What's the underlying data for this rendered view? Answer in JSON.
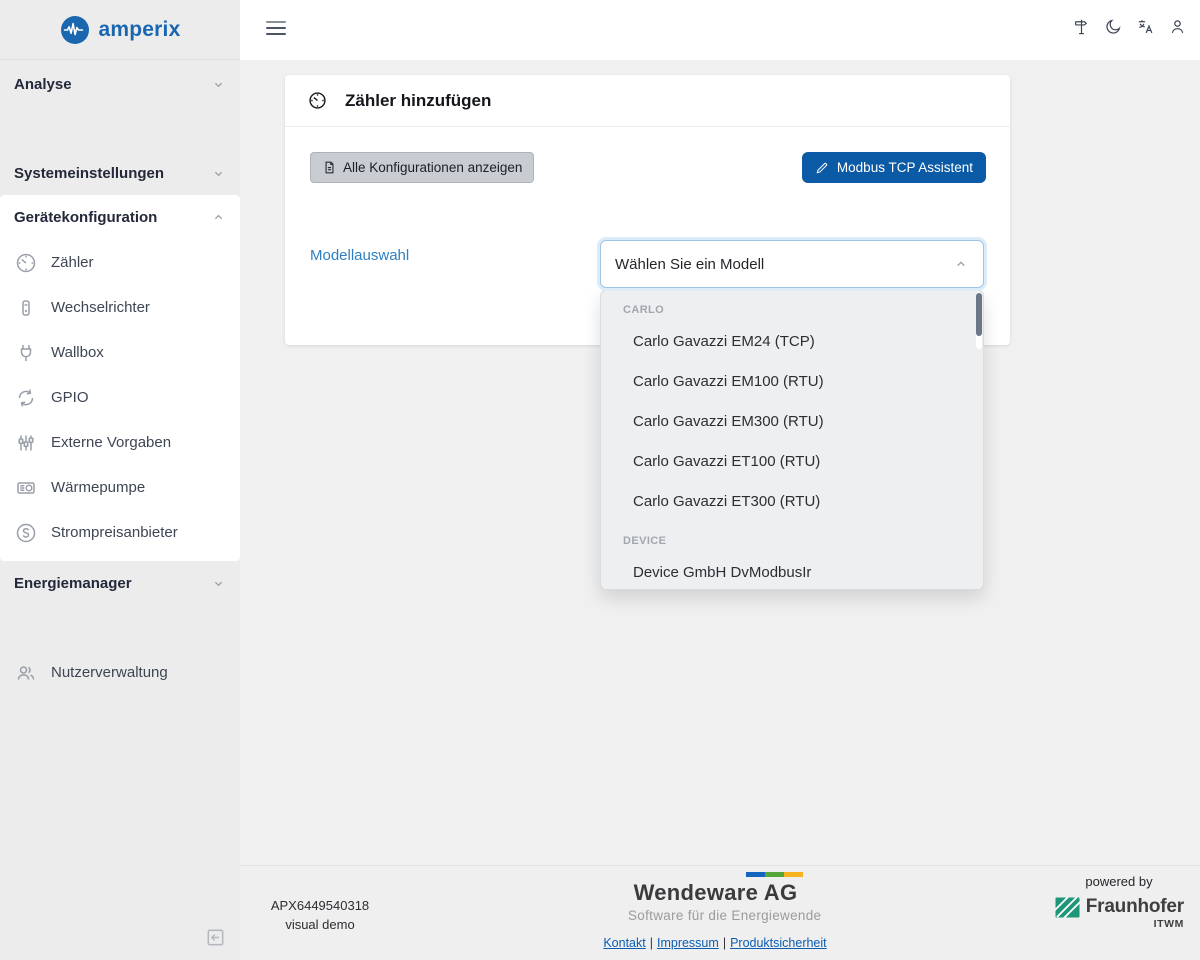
{
  "brand": {
    "name": "amperix"
  },
  "topbar": {
    "icons": [
      "signpost-icon",
      "dark-mode-icon",
      "translate-icon",
      "account-icon"
    ]
  },
  "sidebar": {
    "groups": [
      {
        "label": "Analyse",
        "state": "collapsed"
      },
      {
        "label": "Systemeinstellungen",
        "state": "collapsed"
      },
      {
        "label": "Gerätekonfiguration",
        "state": "expanded"
      },
      {
        "label": "Energiemanager",
        "state": "collapsed"
      }
    ],
    "device_items": [
      {
        "label": "Zähler",
        "icon": "meter-icon"
      },
      {
        "label": "Wechselrichter",
        "icon": "inverter-icon"
      },
      {
        "label": "Wallbox",
        "icon": "plug-icon"
      },
      {
        "label": "GPIO",
        "icon": "gpio-icon"
      },
      {
        "label": "Externe Vorgaben",
        "icon": "sliders-icon"
      },
      {
        "label": "Wärmepumpe",
        "icon": "heatpump-icon"
      },
      {
        "label": "Strompreisanbieter",
        "icon": "price-icon"
      }
    ],
    "user_item": {
      "label": "Nutzerverwaltung",
      "icon": "users-icon"
    }
  },
  "main": {
    "card": {
      "title": "Zähler hinzufügen",
      "show_all_button": "Alle Konfigurationen anzeigen",
      "assistant_button": "Modbus TCP Assistent",
      "model_label": "Modellauswahl",
      "select_value": "Wählen Sie ein Modell"
    },
    "dropdown": {
      "groups": [
        {
          "label": "CARLO",
          "items": [
            "Carlo Gavazzi EM24 (TCP)",
            "Carlo Gavazzi EM100 (RTU)",
            "Carlo Gavazzi EM300 (RTU)",
            "Carlo Gavazzi ET100 (RTU)",
            "Carlo Gavazzi ET300 (RTU)"
          ]
        },
        {
          "label": "DEVICE",
          "items": [
            "Device GmbH DvModbusIr"
          ]
        }
      ]
    }
  },
  "footer": {
    "device_id": "APX6449540318",
    "mode": "visual demo",
    "company": "Wendeware AG",
    "tagline": "Software für die Energiewende",
    "links": [
      {
        "label": "Kontakt"
      },
      {
        "label": "Impressum"
      },
      {
        "label": "Produktsicherheit"
      }
    ],
    "separator": "|",
    "powered_by": "powered by",
    "partner": "Fraunhofer",
    "partner_institute": "ITWM"
  },
  "colors": {
    "brand_blue": "#1a67b0",
    "primary_button_blue": "#0b5aa6",
    "model_label_blue": "#2e7fc2",
    "link_blue": "#0b5db1",
    "bar_blue": "#1565c0",
    "bar_green": "#57a639",
    "bar_yellow": "#f5b31f",
    "fraunhofer_green": "#1f9678"
  }
}
